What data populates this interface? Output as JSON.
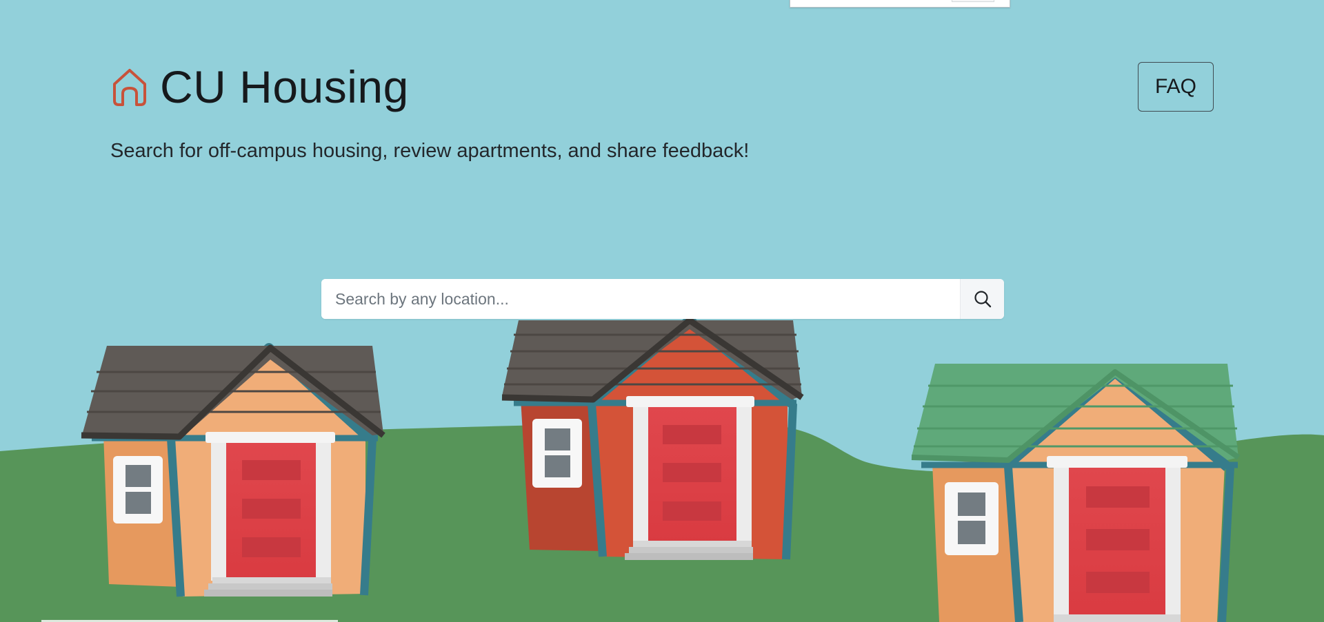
{
  "header": {
    "logo_icon": "house-outline-icon",
    "title": "CU Housing",
    "faq_label": "FAQ"
  },
  "tagline": "Search for off-campus housing, review apartments, and share feedback!",
  "search": {
    "placeholder": "Search by any location...",
    "icon": "search-icon"
  },
  "colors": {
    "sky": "#92d0da",
    "grass": "#579559",
    "logo_accent": "#c8523a",
    "door_red": "#dd3f45",
    "trim_teal": "#367c8b"
  }
}
